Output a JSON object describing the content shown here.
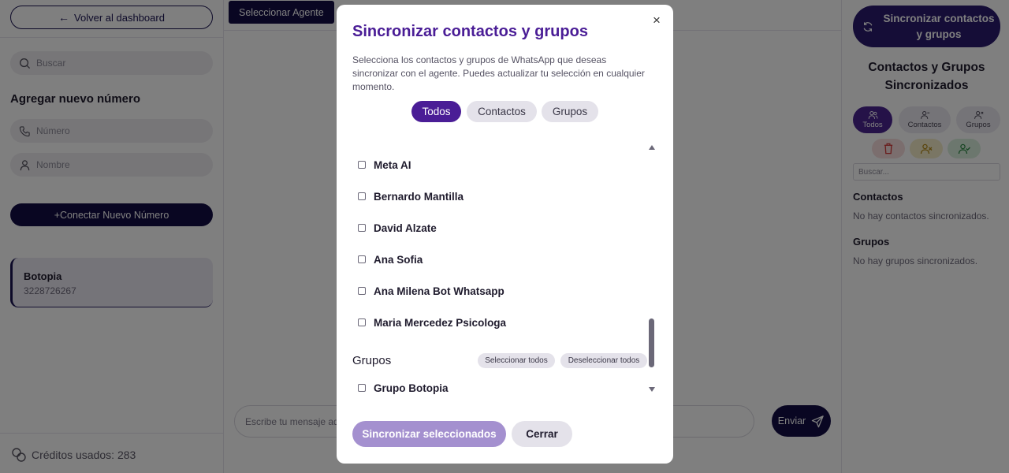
{
  "left_sidebar": {
    "back_label": "Volver al dashboard",
    "search_placeholder": "Buscar",
    "add_title": "Agregar nuevo número",
    "number_placeholder": "Número",
    "name_placeholder": "Nombre",
    "connect_label": "+Conectar Nuevo Número",
    "agent": {
      "name": "Botopia",
      "phone": "3228726267"
    },
    "credits_label": "Créditos usados: 283"
  },
  "center": {
    "select_agent_label": "Seleccionar Agente",
    "message_placeholder": "Escribe tu mensaje aquí...",
    "send_label": "Enviar"
  },
  "right_panel": {
    "sync_button_label": "Sincronizar contactos y grupos",
    "title": "Contactos y Grupos Sincronizados",
    "tabs": [
      {
        "label": "Todos",
        "icon": "users-icon",
        "active": true
      },
      {
        "label": "Contactos",
        "icon": "user-icon",
        "active": false
      },
      {
        "label": "Grupos",
        "icon": "user-x-icon",
        "active": false
      }
    ],
    "search_placeholder": "Buscar...",
    "contacts_heading": "Contactos",
    "contacts_empty": "No hay contactos sincronizados.",
    "groups_heading": "Grupos",
    "groups_empty": "No hay grupos sincronizados."
  },
  "modal": {
    "title": "Sincronizar contactos y grupos",
    "description": "Selecciona los contactos y grupos de WhatsApp que deseas sincronizar con el agente. Puedes actualizar tu selección en cualquier momento.",
    "close_symbol": "×",
    "tabs": [
      {
        "label": "Todos",
        "active": true
      },
      {
        "label": "Contactos",
        "active": false
      },
      {
        "label": "Grupos",
        "active": false
      }
    ],
    "contacts": [
      {
        "name": "Meta AI",
        "checked": false
      },
      {
        "name": "Bernardo Mantilla",
        "checked": false
      },
      {
        "name": "David Alzate",
        "checked": false
      },
      {
        "name": "Ana Sofia",
        "checked": false
      },
      {
        "name": "Ana Milena Bot Whatsapp",
        "checked": false
      },
      {
        "name": "Maria Mercedez Psicologa",
        "checked": false
      }
    ],
    "groups_heading": "Grupos",
    "select_all_label": "Seleccionar todos",
    "deselect_all_label": "Deseleccionar todos",
    "groups": [
      {
        "name": "Grupo Botopia",
        "checked": false
      }
    ],
    "sync_selected_label": "Sincronizar seleccionados",
    "close_label": "Cerrar"
  }
}
